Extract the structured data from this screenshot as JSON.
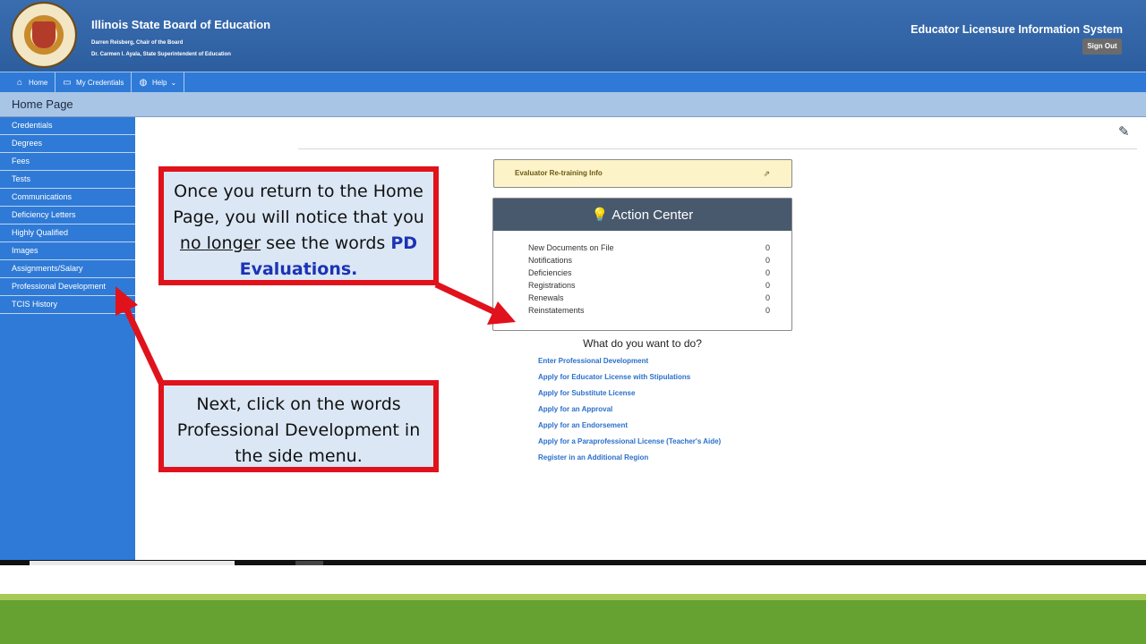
{
  "header": {
    "org_title": "Illinois State Board of Education",
    "chair": "Darren Reisberg, Chair of the Board",
    "superintendent": "Dr. Carmen I. Ayala, State Superintendent of Education",
    "system_title": "Educator Licensure Information System",
    "sign_out": "Sign Out"
  },
  "nav": {
    "items": [
      {
        "label": "Home",
        "icon": "home-icon"
      },
      {
        "label": "My Credentials",
        "icon": "monitor-icon"
      },
      {
        "label": "Help",
        "icon": "help-icon"
      }
    ]
  },
  "page": {
    "title": "Home Page"
  },
  "sidebar": {
    "items": [
      {
        "label": "Credentials"
      },
      {
        "label": "Degrees"
      },
      {
        "label": "Fees"
      },
      {
        "label": "Tests"
      },
      {
        "label": "Communications"
      },
      {
        "label": "Deficiency Letters"
      },
      {
        "label": "Highly Qualified"
      },
      {
        "label": "Images"
      },
      {
        "label": "Assignments/Salary"
      },
      {
        "label": "Professional Development"
      },
      {
        "label": "TCIS History"
      }
    ]
  },
  "retraining": {
    "label": "Evaluator Re-training Info"
  },
  "action_center": {
    "title": "Action Center",
    "rows": [
      {
        "label": "New Documents on File",
        "value": "0"
      },
      {
        "label": "Notifications",
        "value": "0"
      },
      {
        "label": "Deficiencies",
        "value": "0"
      },
      {
        "label": "Registrations",
        "value": "0"
      },
      {
        "label": "Renewals",
        "value": "0"
      },
      {
        "label": "Reinstatements",
        "value": "0"
      }
    ]
  },
  "what_do": {
    "heading": "What do you want to do?",
    "links": [
      "Enter Professional Development",
      "Apply for Educator License with Stipulations",
      "Apply for Substitute License",
      "Apply for an Approval",
      "Apply for an Endorsement",
      "Apply for a Paraprofessional License (Teacher's Aide)",
      "Register in an Additional Region"
    ]
  },
  "callouts": {
    "first": {
      "part1": "Once you return to the Home Page, you will notice that you ",
      "underlined": "no longer",
      "part2": " see the words ",
      "highlight": "PD Evaluations."
    },
    "second": {
      "text": "Next, click on the words Professional Development in the side menu."
    }
  },
  "colors": {
    "header_blue": "#2c5e9f",
    "nav_blue": "#2f7ad6",
    "callout_red": "#e0121c",
    "callout_fill": "#dbe7f5",
    "highlight_blue": "#1c33b5",
    "green_strip": "#66a232"
  }
}
